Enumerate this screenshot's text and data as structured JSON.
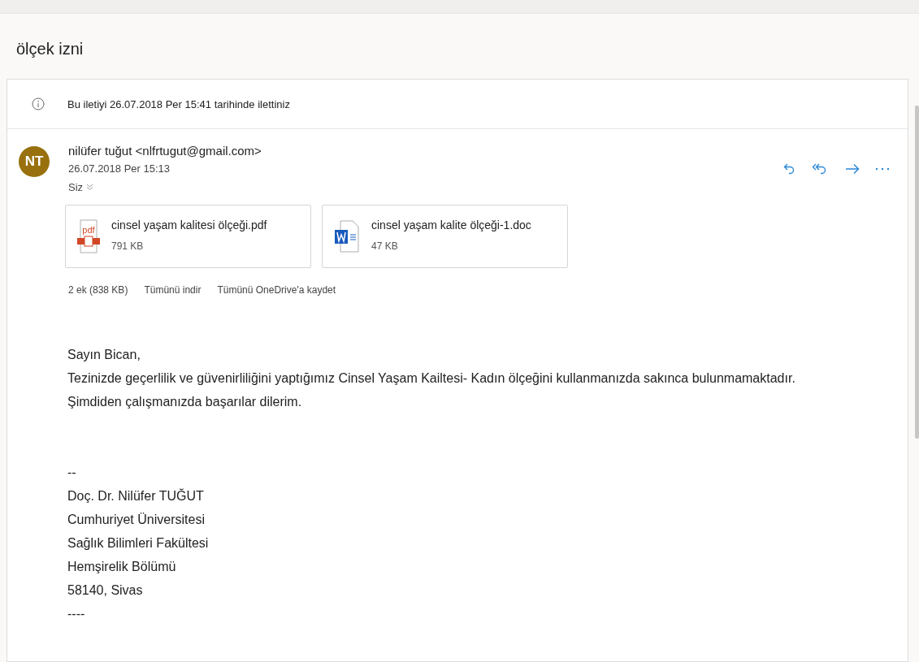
{
  "subject": "ölçek izni",
  "info": "Bu iletiyi 26.07.2018 Per 15:41 tarihinde ilettiniz",
  "message": {
    "avatar": "NT",
    "from": "nilüfer tuğut <nlfrtugut@gmail.com>",
    "date": "26.07.2018 Per 15:13",
    "to": "Siz"
  },
  "attachments": [
    {
      "kind": "pdf",
      "name": "cinsel yaşam kalitesi ölçeği.pdf",
      "size": "791 KB"
    },
    {
      "kind": "word",
      "name": "cinsel yaşam kalite ölçeği-1.doc",
      "size": "47 KB"
    }
  ],
  "attachment_summary": "2 ek (838 KB)",
  "attachment_actions": [
    "Tümünü indir",
    "Tümünü OneDrive'a kaydet"
  ],
  "body": [
    "Sayın Bican,",
    "Tezinizde geçerlilik ve güvenirliliğini yaptığımız Cinsel Yaşam Kailtesi- Kadın ölçeğini kullanmanızda sakınca bulunmamaktadır.",
    "Şimdiden çalışmanızda başarılar dilerim."
  ],
  "signature": [
    "--",
    "Doç. Dr. Nilüfer TUĞUT",
    "Cumhuriyet Üniversitesi",
    "Sağlık Bilimleri Fakültesi",
    "Hemşirelik Bölümü",
    "58140, Sivas",
    "----"
  ]
}
